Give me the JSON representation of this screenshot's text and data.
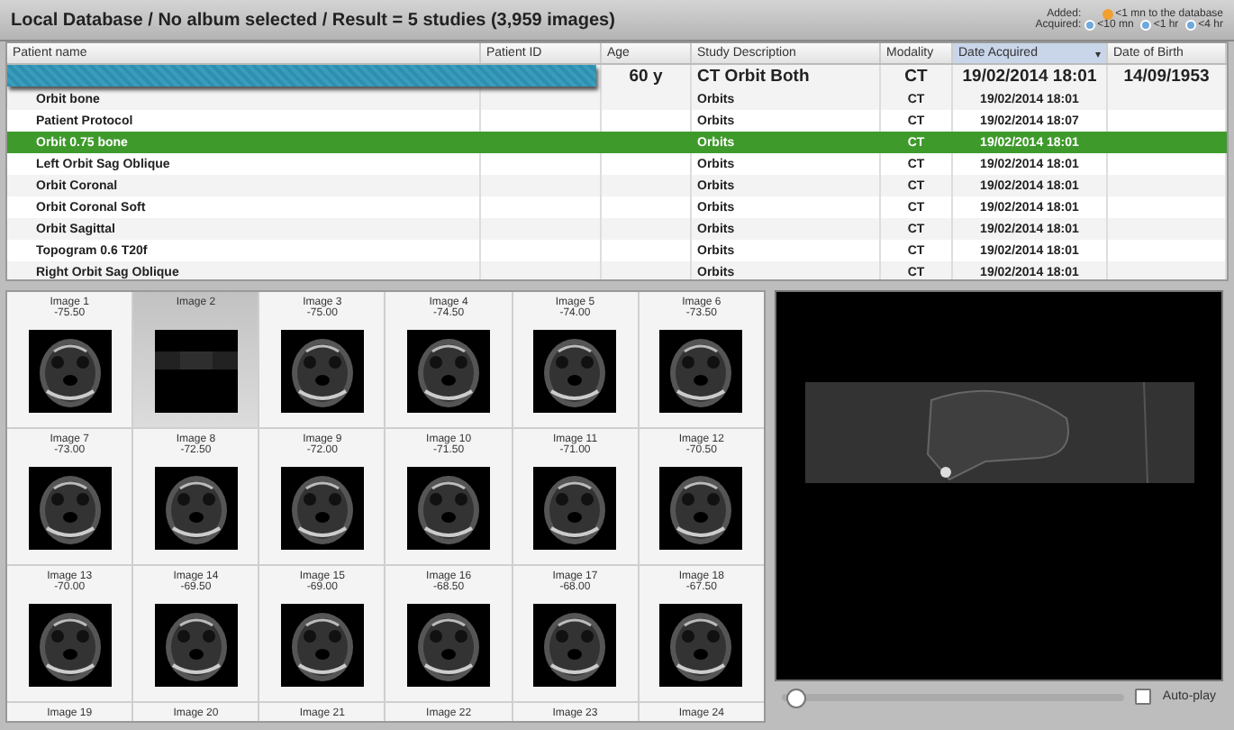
{
  "title": "Local Database / No album selected / Result = 5 studies (3,959 images)",
  "legend": [
    {
      "label": "Added:",
      "kind": "dot",
      "items": [
        {
          "text": "<1 mn to the database",
          "color": "#f0a030"
        }
      ]
    },
    {
      "label": "Acquired:",
      "kind": "clock",
      "items": [
        {
          "text": "<10 mn",
          "color": "#6fa8dc"
        },
        {
          "text": "<1 hr",
          "color": "#6fa8dc"
        },
        {
          "text": "<4 hr",
          "color": "#6fa8dc"
        }
      ]
    }
  ],
  "table": {
    "columns": [
      {
        "label": "Patient name",
        "sorted": false
      },
      {
        "label": "Patient ID",
        "sorted": false
      },
      {
        "label": "Age",
        "sorted": false
      },
      {
        "label": "Study Description",
        "sorted": false
      },
      {
        "label": "Modality",
        "sorted": false
      },
      {
        "label": "Date Acquired",
        "sorted": true,
        "sort_icon": "▾"
      },
      {
        "label": "Date of Birth",
        "sorted": false
      }
    ],
    "rows": [
      {
        "kind": "study",
        "redacted": true,
        "selected": false,
        "cells": [
          "",
          "",
          "60 y",
          "CT Orbit Both",
          "CT",
          "19/02/2014 18:01",
          "14/09/1953"
        ]
      },
      {
        "kind": "series",
        "redacted": false,
        "selected": false,
        "cells": [
          "Orbit  bone",
          "",
          "",
          "Orbits",
          "CT",
          "19/02/2014 18:01",
          ""
        ]
      },
      {
        "kind": "series",
        "redacted": false,
        "selected": false,
        "cells": [
          "Patient Protocol",
          "",
          "",
          "Orbits",
          "CT",
          "19/02/2014 18:07",
          ""
        ]
      },
      {
        "kind": "series",
        "redacted": false,
        "selected": true,
        "cells": [
          "Orbit  0.75  bone",
          "",
          "",
          "Orbits",
          "CT",
          "19/02/2014 18:01",
          ""
        ]
      },
      {
        "kind": "series",
        "redacted": false,
        "selected": false,
        "cells": [
          "Left Orbit Sag Oblique",
          "",
          "",
          "Orbits",
          "CT",
          "19/02/2014 18:01",
          ""
        ]
      },
      {
        "kind": "series",
        "redacted": false,
        "selected": false,
        "cells": [
          "Orbit Coronal",
          "",
          "",
          "Orbits",
          "CT",
          "19/02/2014 18:01",
          ""
        ]
      },
      {
        "kind": "series",
        "redacted": false,
        "selected": false,
        "cells": [
          "Orbit Coronal Soft",
          "",
          "",
          "Orbits",
          "CT",
          "19/02/2014 18:01",
          ""
        ]
      },
      {
        "kind": "series",
        "redacted": false,
        "selected": false,
        "cells": [
          "Orbit Sagittal",
          "",
          "",
          "Orbits",
          "CT",
          "19/02/2014 18:01",
          ""
        ]
      },
      {
        "kind": "series",
        "redacted": false,
        "selected": false,
        "cells": [
          "Topogram  0.6  T20f",
          "",
          "",
          "Orbits",
          "CT",
          "19/02/2014 18:01",
          ""
        ]
      },
      {
        "kind": "series",
        "redacted": false,
        "selected": false,
        "cells": [
          "Right Orbit Sag Oblique",
          "",
          "",
          "Orbits",
          "CT",
          "19/02/2014 18:01",
          ""
        ]
      }
    ]
  },
  "thumbnails": [
    {
      "label": "Image 1",
      "value": "-75.50",
      "selected": false,
      "kind": "axial"
    },
    {
      "label": "Image 2",
      "selected": true,
      "kind": "topogram"
    },
    {
      "label": "Image 3",
      "value": "-75.00",
      "selected": false,
      "kind": "axial"
    },
    {
      "label": "Image 4",
      "value": "-74.50",
      "selected": false,
      "kind": "axial"
    },
    {
      "label": "Image 5",
      "value": "-74.00",
      "selected": false,
      "kind": "axial"
    },
    {
      "label": "Image 6",
      "value": "-73.50",
      "selected": false,
      "kind": "axial"
    },
    {
      "label": "Image 7",
      "value": "-73.00",
      "selected": false,
      "kind": "axial"
    },
    {
      "label": "Image 8",
      "value": "-72.50",
      "selected": false,
      "kind": "axial"
    },
    {
      "label": "Image 9",
      "value": "-72.00",
      "selected": false,
      "kind": "axial"
    },
    {
      "label": "Image 10",
      "value": "-71.50",
      "selected": false,
      "kind": "axial"
    },
    {
      "label": "Image 11",
      "value": "-71.00",
      "selected": false,
      "kind": "axial"
    },
    {
      "label": "Image 12",
      "value": "-70.50",
      "selected": false,
      "kind": "axial"
    },
    {
      "label": "Image 13",
      "value": "-70.00",
      "selected": false,
      "kind": "axial"
    },
    {
      "label": "Image 14",
      "value": "-69.50",
      "selected": false,
      "kind": "axial"
    },
    {
      "label": "Image 15",
      "value": "-69.00",
      "selected": false,
      "kind": "axial"
    },
    {
      "label": "Image 16",
      "value": "-68.50",
      "selected": false,
      "kind": "axial"
    },
    {
      "label": "Image 17",
      "value": "-68.00",
      "selected": false,
      "kind": "axial"
    },
    {
      "label": "Image 18",
      "value": "-67.50",
      "selected": false,
      "kind": "axial"
    },
    {
      "label": "Image 19",
      "selected": false,
      "kind": "cut"
    },
    {
      "label": "Image 20",
      "selected": false,
      "kind": "cut"
    },
    {
      "label": "Image 21",
      "selected": false,
      "kind": "cut"
    },
    {
      "label": "Image 22",
      "selected": false,
      "kind": "cut"
    },
    {
      "label": "Image 23",
      "selected": false,
      "kind": "cut"
    },
    {
      "label": "Image 24",
      "selected": false,
      "kind": "cut"
    }
  ],
  "viewer": {
    "slider": {
      "level": 0
    },
    "autoplay": {
      "label": "Auto-play",
      "checked": false
    }
  }
}
